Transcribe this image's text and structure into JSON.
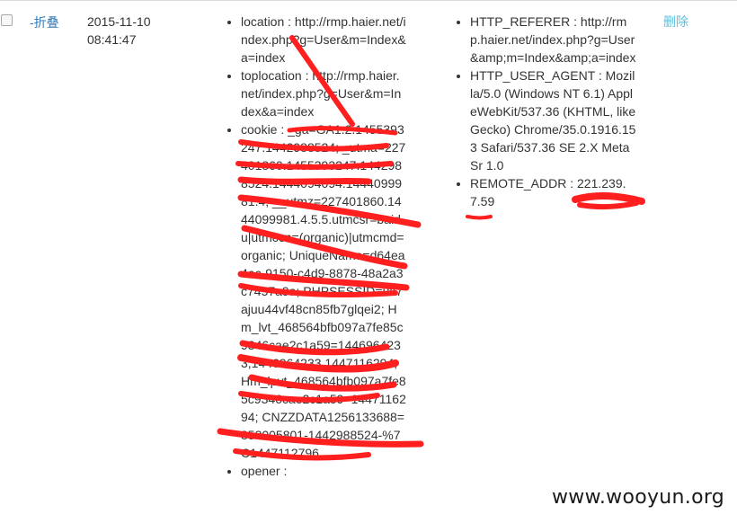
{
  "row": {
    "toggle_label": "-折叠",
    "date": "2015-11-10",
    "time": "08:41:47",
    "request_items": [
      "location : http://rmp.haier.net/index.php?g=User&m=Index&a=index",
      "toplocation : http://rmp.haier.net/index.php?g=User&m=Index&a=index",
      "cookie : _ga=GA1.2.1455393247.1442988524; _utma=227401860.1455393247.1442988524.1444094094.1444099981.4; __utmz=227401860.1444099981.4.5.5.utmcsr=baidu|utmccn=(organic)|utmcmd=organic; UniqueName=d64ea4ac-9150-c4d9-8878-48a2a3c7457a9a; PHPSESSID=uk7ajuu44vf48cn85fb7glqei2; Hm_lvt_468564bfb097a7fe85c9346cae2c1a59=1446964233,1446964233,1447116294; Hm_lpvt_468564bfb097a7fe85c9346cae2c1a59=1447116294; CNZZDATA1256133688=853005801-1442988524-%7C1447112796",
      "opener :"
    ],
    "header_items": [
      "HTTP_REFERER : http://rmp.haier.net/index.php?g=User&amp;m=Index&amp;a=index",
      "HTTP_USER_AGENT : Mozilla/5.0 (Windows NT 6.1) AppleWebKit/537.36 (KHTML, like Gecko) Chrome/35.0.1916.153 Safari/537.36 SE 2.X MetaSr 1.0",
      "REMOTE_ADDR : 221.239.7.59"
    ],
    "delete_label": "删除"
  },
  "watermark": "www.wooyun.org",
  "colors": {
    "link": "#337ab7",
    "delete": "#5bc0de",
    "redaction": "#ff1f1f"
  }
}
